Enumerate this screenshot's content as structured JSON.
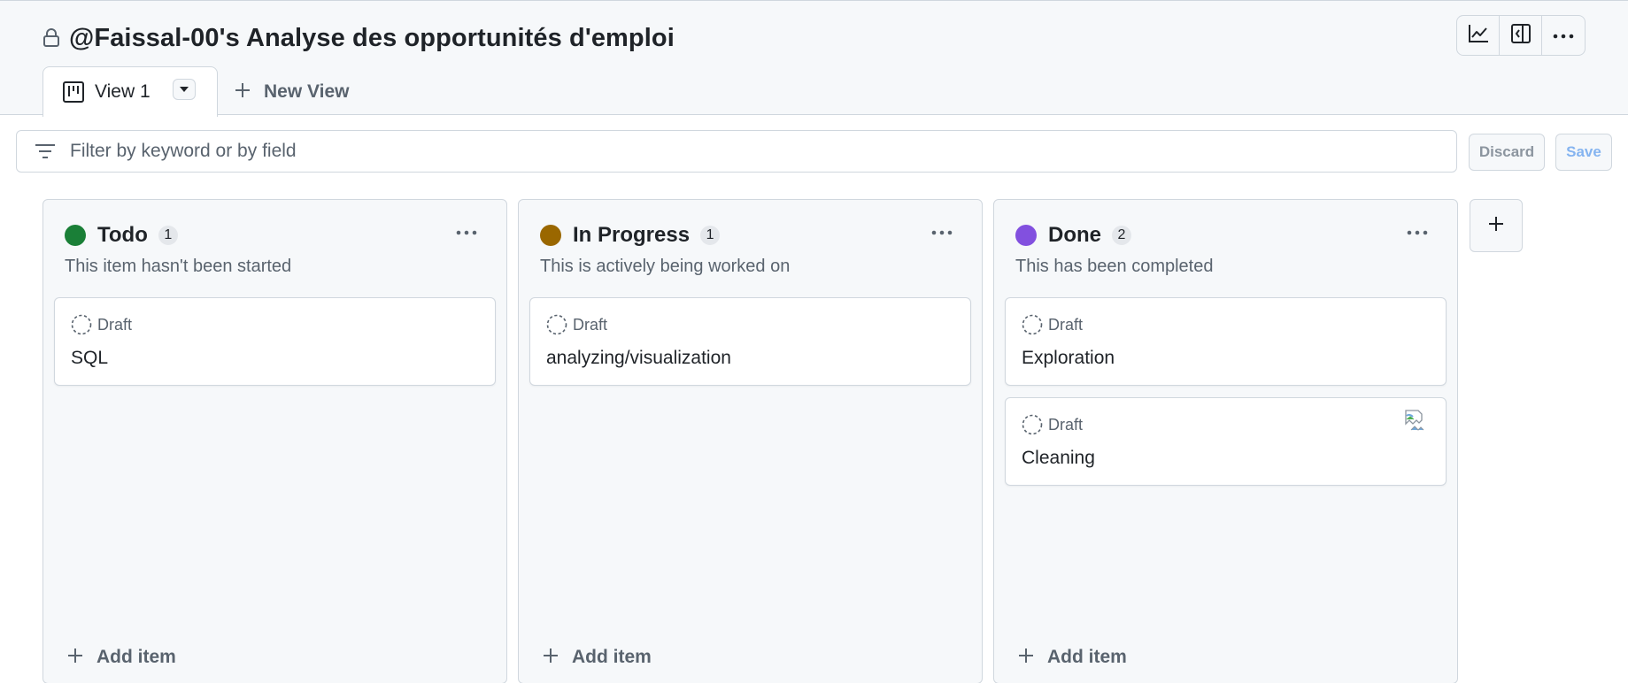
{
  "project": {
    "title": "@Faissal-00's Analyse des opportunités d'emploi",
    "icons": {
      "lock": "lock-icon",
      "insights": "graph-icon",
      "side_panel": "sidebar-expand-icon",
      "more": "kebab-horizontal-icon"
    }
  },
  "tabs": {
    "active": {
      "label": "View 1",
      "icon": "project-board-icon"
    },
    "new_view_label": "New View"
  },
  "filter": {
    "placeholder": "Filter by keyword or by field",
    "value": "",
    "discard_label": "Discard",
    "save_label": "Save"
  },
  "columns": [
    {
      "name": "Todo",
      "count": "1",
      "color": "#1a7f37",
      "description": "This item hasn't been started",
      "add_item_label": "Add item",
      "cards": [
        {
          "status": "Draft",
          "title": "SQL"
        }
      ]
    },
    {
      "name": "In Progress",
      "count": "1",
      "color": "#9a6700",
      "description": "This is actively being worked on",
      "add_item_label": "Add item",
      "cards": [
        {
          "status": "Draft",
          "title": "analyzing/visualization"
        }
      ]
    },
    {
      "name": "Done",
      "count": "2",
      "color": "#8250df",
      "description": "This has been completed",
      "add_item_label": "Add item",
      "cards": [
        {
          "status": "Draft",
          "title": "Exploration"
        },
        {
          "status": "Draft",
          "title": "Cleaning",
          "assignee_avatar": "broken-image-icon"
        }
      ]
    }
  ],
  "colors": {
    "accent_blue": "#0969da",
    "border": "#d0d7de",
    "muted_text": "#59636e"
  }
}
